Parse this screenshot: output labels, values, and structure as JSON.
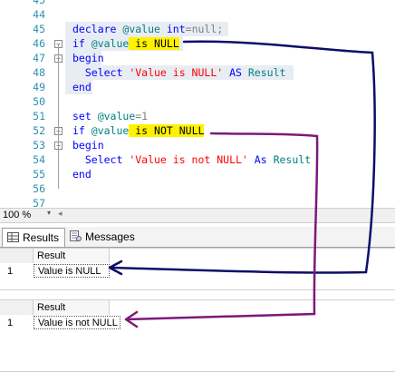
{
  "editor": {
    "lines": [
      {
        "num": "45"
      },
      {
        "num": "44"
      },
      {
        "num": "45",
        "code": [
          {
            "t": "declare",
            "c": "kw"
          },
          {
            "t": " @value ",
            "c": "var"
          },
          {
            "t": "int",
            "c": "kw"
          },
          {
            "t": "=",
            "c": "gray"
          },
          {
            "t": "null",
            "c": "gray"
          },
          {
            "t": ";",
            "c": "gray"
          }
        ]
      },
      {
        "num": "46"
      },
      {
        "num": "47"
      },
      {
        "num": "48"
      },
      {
        "num": "49"
      },
      {
        "num": "50"
      },
      {
        "num": "51"
      },
      {
        "num": "52"
      },
      {
        "num": "53"
      },
      {
        "num": "54"
      },
      {
        "num": "55"
      },
      {
        "num": "56"
      },
      {
        "num": "57"
      }
    ],
    "code": {
      "l45": {
        "p1": "declare",
        "p2": " @value ",
        "p3": "int",
        "p4": "=null;"
      },
      "l46": {
        "p1": "if ",
        "p2": "@value",
        "p3": " is NULL"
      },
      "l47": {
        "p1": "begin"
      },
      "l48": {
        "p1": "  Select ",
        "p2": "'Value is NULL'",
        "p3": " AS ",
        "p4": "Result"
      },
      "l49": {
        "p1": "end"
      },
      "l51": {
        "p1": "set ",
        "p2": "@value",
        "p3": "=1"
      },
      "l52": {
        "p1": "if ",
        "p2": "@value",
        "p3": " is NOT NULL"
      },
      "l53": {
        "p1": "begin"
      },
      "l54": {
        "p1": "  Select ",
        "p2": "'Value is not NULL'",
        "p3": " As ",
        "p4": "Result"
      },
      "l55": {
        "p1": "end"
      }
    },
    "line_numbers": [
      "45",
      "44",
      "45",
      "46",
      "47",
      "48",
      "49",
      "50",
      "51",
      "52",
      "53",
      "54",
      "55",
      "56",
      "57"
    ]
  },
  "statusbar": {
    "zoom": "100 %",
    "dropdown": "▾",
    "scroll": "◂"
  },
  "tabs": {
    "results": "Results",
    "messages": "Messages"
  },
  "grid1": {
    "header": "Result",
    "row_num": "1",
    "value": "Value is NULL"
  },
  "grid2": {
    "header": "Result",
    "row_num": "1",
    "value": "Value is not NULL"
  },
  "colors": {
    "highlight": "#fff200",
    "arrow1": "#0d0d6b",
    "arrow2": "#7a1a7a"
  }
}
